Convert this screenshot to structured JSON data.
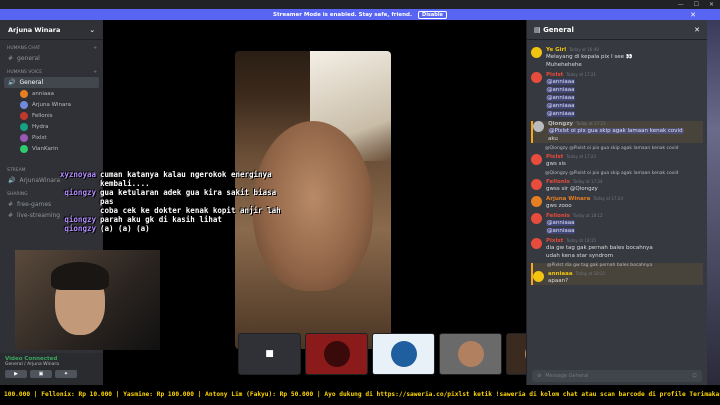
{
  "banner": {
    "text": "Streamer Mode is enabled. Stay safe, friend.",
    "button": "Disable"
  },
  "server": {
    "name": "Arjuna Winara"
  },
  "sidebar": {
    "cat_chat": "HUMANS CHAT",
    "chat_channel": "general",
    "cat_voice": "HUMANS VOICE",
    "voice_channel": "General",
    "voice_users": [
      {
        "name": "anniaaa",
        "color": "#e67e22"
      },
      {
        "name": "Arjuna Winara",
        "color": "#7289da"
      },
      {
        "name": "Fellonis",
        "color": "#c0392b"
      },
      {
        "name": "Hydra",
        "color": "#16a085"
      },
      {
        "name": "Pixlst",
        "color": "#9b59b6"
      },
      {
        "name": "VianKarin",
        "color": "#2ecc71"
      }
    ],
    "cat_stream": "STREAM",
    "stream_channel": "ArjunaWinara",
    "cat_sharing": "SHARING",
    "sharing_channel1": "free-games",
    "sharing_channel2": "live-streaming"
  },
  "panel": {
    "status": "Video Connected",
    "location": "General / Arjuna Winara"
  },
  "overlay": [
    {
      "name": "xyznoyaa",
      "text": "cuman katanya kalau ngerokok energinya"
    },
    {
      "name": "",
      "text": "kembali...."
    },
    {
      "name": "qiongzy",
      "text": "gua ketularan adek gua kira sakit biasa pas"
    },
    {
      "name": "",
      "text": "coba cek ke dokter kenak kopit anjir lah"
    },
    {
      "name": "qiongzy",
      "text": "parah aku gk di kasih lihat"
    },
    {
      "name": "qiongzy",
      "text": "(a) (a) (a)"
    }
  ],
  "chat": {
    "title": "General",
    "input_placeholder": "Message General",
    "messages": [
      {
        "author": "Ye Girl",
        "color": "#f1c40f",
        "ts": "Today at 16:48",
        "lines": [
          "Melayang di kepala pix I see 👀",
          "Muhehehehe"
        ]
      },
      {
        "author": "Pixlst",
        "color": "#e74c3c",
        "ts": "Today at 17:21",
        "lines": [
          "@anniaaa",
          "@anniaaa",
          "@anniaaa",
          "@anniaaa",
          "@anniaaa"
        ]
      },
      {
        "author": "Qiongzy",
        "color": "#b9bbbe",
        "ts": "Today at 17:23",
        "lines": [
          "@Pixlst oi pix gua skip agak lamaan kenak covid",
          "aku"
        ]
      },
      {
        "author": "Pixlst",
        "color": "#e74c3c",
        "ts": "Today at 17:23",
        "reply": "@Qiongzy @Pixlst oi pix gua skip agak lamaan kenak covid",
        "lines": [
          "gws sis"
        ]
      },
      {
        "author": "Fellonis",
        "color": "#e74c3c",
        "ts": "Today at 17:24",
        "reply": "@Qiongzy @Pixlst oi pix gua skip agak lamaan kenak covid",
        "lines": [
          "gwss sir @Qiongzy"
        ]
      },
      {
        "author": "Arjuna Winara",
        "color": "#e67e22",
        "ts": "Today at 17:24",
        "lines": [
          "gws zooo"
        ]
      },
      {
        "author": "Fellonis",
        "color": "#e74c3c",
        "ts": "Today at 18:12",
        "lines": [
          "@anniaaa",
          "@anniaaa"
        ]
      },
      {
        "author": "Pixlst",
        "color": "#e74c3c",
        "ts": "Today at 18:15",
        "lines": [
          "dia gw tag gak pernah bales bocahnya",
          "udah kena star syndrom"
        ]
      },
      {
        "author": "anniaaa",
        "color": "#f1c40f",
        "ts": "Today at 18:21",
        "reply": "@Pixlst dia gw tag gak pernah bales bocahnya",
        "lines": [
          "apaan?"
        ]
      }
    ]
  },
  "ticker": "100.000 | Fellonix: Rp 10.000 | Yasmine: Rp 100.000 | Antony Lim (Fakyu): Rp 50.000 |  Ayo dukung di https://saweria.co/pixlst ketik !saweria di kolom chat atau scan barcode di profile Terimakasih!"
}
